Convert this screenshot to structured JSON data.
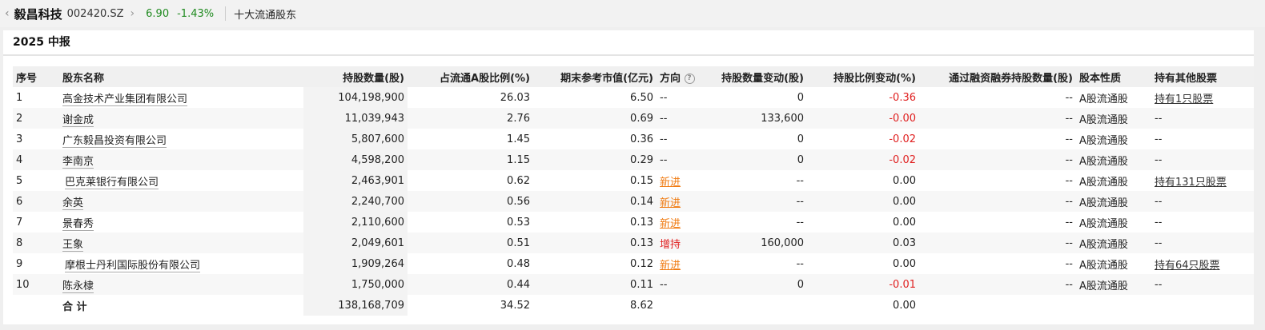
{
  "header": {
    "back_glyph": "‹",
    "stock_name": "毅昌科技",
    "stock_code": "002420.SZ",
    "forward_glyph": "›",
    "price": "6.90",
    "change_pct": "-1.43%",
    "page_title": "十大流通股东"
  },
  "section": {
    "title": "2025 中报"
  },
  "table": {
    "columns": [
      "序号",
      "股东名称",
      "持股数量(股)",
      "占流通A股比例(%)",
      "期末参考市值(亿元)",
      "方向",
      "持股数量变动(股)",
      "持股比例变动(%)",
      "通过融资融券持股数量(股)",
      "股本性质",
      "持有其他股票"
    ],
    "rows": [
      {
        "no": "1",
        "name": "高金技术产业集团有限公司",
        "shares": "104,198,900",
        "ratio": "26.03",
        "value": "6.50",
        "dir": "--",
        "chg": "0",
        "chg_pct": "-0.36",
        "margin": "--",
        "type": "A股流通股",
        "other": "持有1只股票",
        "info": false
      },
      {
        "no": "2",
        "name": "谢金成",
        "shares": "11,039,943",
        "ratio": "2.76",
        "value": "0.69",
        "dir": "--",
        "chg": "133,600",
        "chg_pct": "-0.00",
        "margin": "--",
        "type": "A股流通股",
        "other": "--",
        "info": false
      },
      {
        "no": "3",
        "name": "广东毅昌投资有限公司",
        "shares": "5,807,600",
        "ratio": "1.45",
        "value": "0.36",
        "dir": "--",
        "chg": "0",
        "chg_pct": "-0.02",
        "margin": "--",
        "type": "A股流通股",
        "other": "--",
        "info": false
      },
      {
        "no": "4",
        "name": "李南京",
        "shares": "4,598,200",
        "ratio": "1.15",
        "value": "0.29",
        "dir": "--",
        "chg": "0",
        "chg_pct": "-0.02",
        "margin": "--",
        "type": "A股流通股",
        "other": "--",
        "info": false
      },
      {
        "no": "5",
        "name": "巴克莱银行有限公司",
        "shares": "2,463,901",
        "ratio": "0.62",
        "value": "0.15",
        "dir": "新进",
        "chg": "--",
        "chg_pct": "0.00",
        "margin": "--",
        "type": "A股流通股",
        "other": "持有131只股票",
        "info": true
      },
      {
        "no": "6",
        "name": "余英",
        "shares": "2,240,700",
        "ratio": "0.56",
        "value": "0.14",
        "dir": "新进",
        "chg": "--",
        "chg_pct": "0.00",
        "margin": "--",
        "type": "A股流通股",
        "other": "--",
        "info": false
      },
      {
        "no": "7",
        "name": "景春秀",
        "shares": "2,110,600",
        "ratio": "0.53",
        "value": "0.13",
        "dir": "新进",
        "chg": "--",
        "chg_pct": "0.00",
        "margin": "--",
        "type": "A股流通股",
        "other": "--",
        "info": false
      },
      {
        "no": "8",
        "name": "王象",
        "shares": "2,049,601",
        "ratio": "0.51",
        "value": "0.13",
        "dir": "增持",
        "chg": "160,000",
        "chg_pct": "0.03",
        "margin": "--",
        "type": "A股流通股",
        "other": "--",
        "info": false
      },
      {
        "no": "9",
        "name": "摩根士丹利国际股份有限公司",
        "shares": "1,909,264",
        "ratio": "0.48",
        "value": "0.12",
        "dir": "新进",
        "chg": "--",
        "chg_pct": "0.00",
        "margin": "--",
        "type": "A股流通股",
        "other": "持有64只股票",
        "info": true
      },
      {
        "no": "10",
        "name": "陈永棣",
        "shares": "1,750,000",
        "ratio": "0.44",
        "value": "0.11",
        "dir": "--",
        "chg": "0",
        "chg_pct": "-0.01",
        "margin": "--",
        "type": "A股流通股",
        "other": "--",
        "info": false
      }
    ],
    "total": {
      "label": "合 计",
      "shares": "138,168,709",
      "ratio": "34.52",
      "value": "8.62",
      "chg_pct": "0.00"
    }
  },
  "colors": {
    "accent_green": "#1f8a1f",
    "negative_red": "#e02020",
    "new_orange": "#f07a10"
  }
}
